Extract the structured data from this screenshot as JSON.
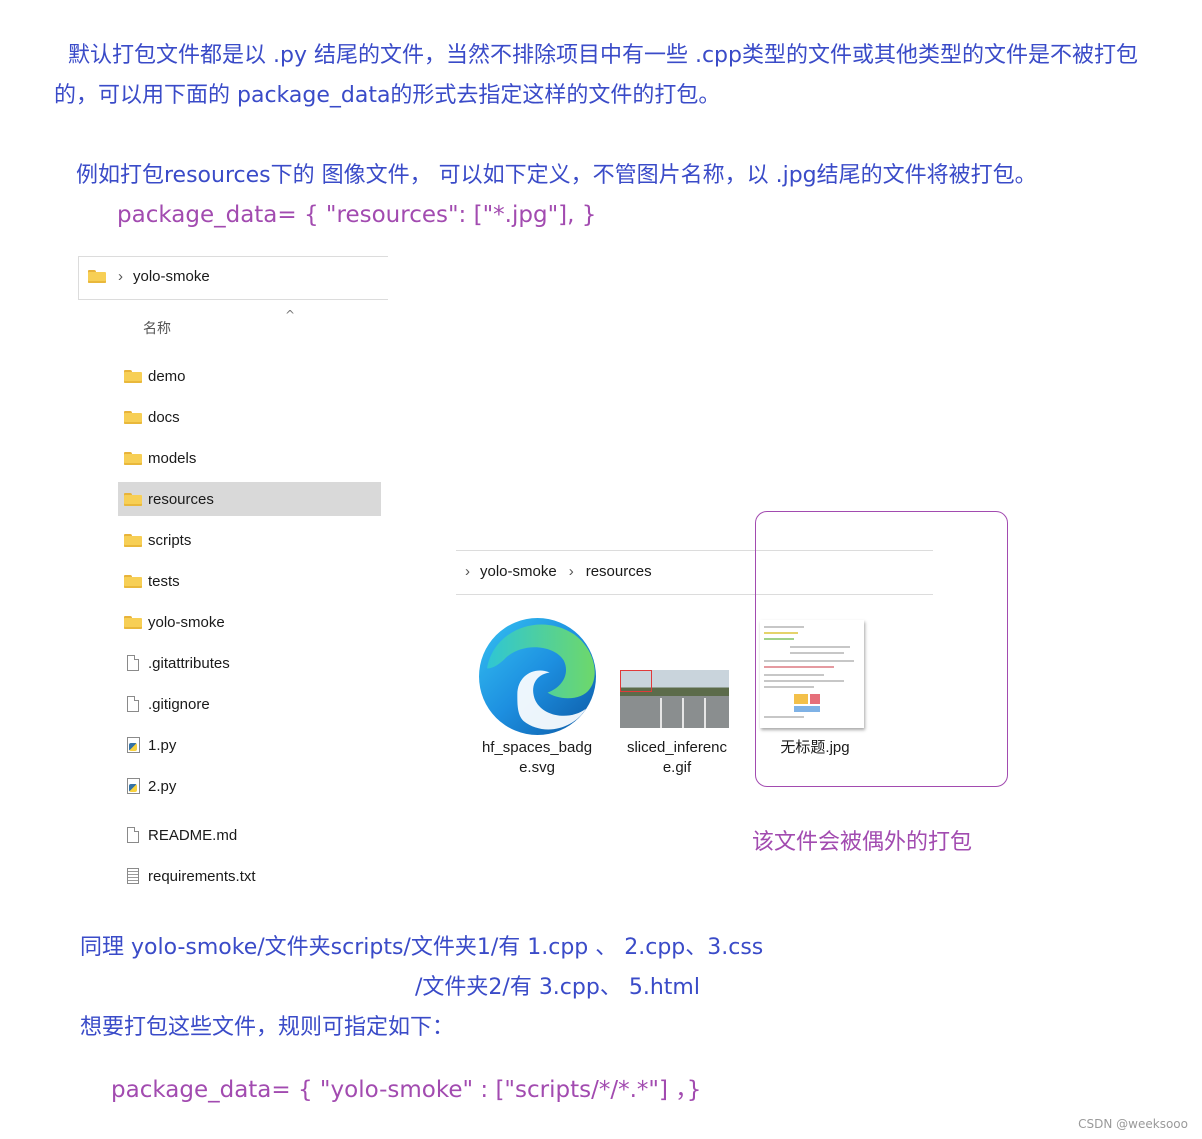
{
  "intro": {
    "line1": "默认打包文件都是以 .py 结尾的文件，当然不排除项目中有一些 .cpp类型的文件或其他类型的文件是不被打包",
    "line2": "的，可以用下面的 package_data的形式去指定这样的文件的打包。"
  },
  "example1": {
    "text": "例如打包resources下的 图像文件， 可以如下定义，不管图片名称，以 .jpg结尾的文件将被打包。",
    "code": "package_data= { \"resources\": [\"*.jpg\"], }"
  },
  "explorer_left": {
    "breadcrumb": "yolo-smoke",
    "column_header": "名称",
    "items": [
      {
        "name": "demo",
        "kind": "folder"
      },
      {
        "name": "docs",
        "kind": "folder"
      },
      {
        "name": "models",
        "kind": "folder"
      },
      {
        "name": "resources",
        "kind": "folder",
        "selected": true
      },
      {
        "name": "scripts",
        "kind": "folder"
      },
      {
        "name": "tests",
        "kind": "folder"
      },
      {
        "name": "yolo-smoke",
        "kind": "folder"
      },
      {
        "name": ".gitattributes",
        "kind": "file"
      },
      {
        "name": ".gitignore",
        "kind": "file"
      },
      {
        "name": "1.py",
        "kind": "python"
      },
      {
        "name": "2.py",
        "kind": "python"
      },
      {
        "name": "README.md",
        "kind": "file"
      },
      {
        "name": "requirements.txt",
        "kind": "text"
      }
    ]
  },
  "explorer_right": {
    "breadcrumb_root": "yolo-smoke",
    "breadcrumb_child": "resources",
    "files": [
      {
        "label_line1": "hf_spaces_badg",
        "label_line2": "e.svg"
      },
      {
        "label_line1": "sliced_inferenc",
        "label_line2": "e.gif"
      },
      {
        "label_line1": "无标题.jpg",
        "label_line2": ""
      }
    ],
    "annotation": "该文件会被偶外的打包",
    "frame_color": "#a24bb0"
  },
  "example2": {
    "line1": "同理 yolo-smoke/文件夹scripts/文件夹1/有  1.cpp 、 2.cpp、3.css",
    "line2": "/文件夹2/有  3.cpp、 5.html",
    "line3": "想要打包这些文件，规则可指定如下：",
    "code": "package_data= { \"yolo-smoke\" : [\"scripts/*/*.*\"] ，}"
  },
  "watermark": "CSDN @weeksooo",
  "colors": {
    "text_blue": "#3a4bc8",
    "code_purple": "#a24bb0",
    "selection": "#d9d9d9"
  }
}
